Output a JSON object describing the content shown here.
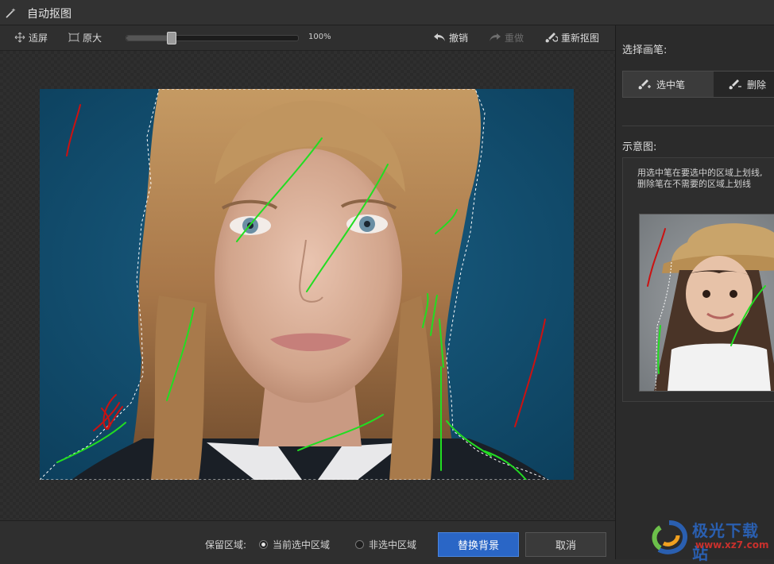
{
  "window": {
    "title": "自动抠图"
  },
  "toolbar": {
    "fit_label": "适屏",
    "actual_label": "原大",
    "zoom_value": "100%",
    "zoom_level": 0.26,
    "undo_label": "撤销",
    "redo_label": "重做",
    "redo_enabled": false,
    "remat_label": "重新抠图"
  },
  "right_panel": {
    "brush_heading": "选择画笔:",
    "brush_tabs": [
      {
        "label": "选中笔",
        "icon": "brush-add-icon",
        "active": true
      },
      {
        "label": "删除",
        "icon": "brush-remove-icon",
        "active": false
      }
    ],
    "hint_heading": "示意图:",
    "hint_lines": [
      "用选中笔在要选中的区域上划线,",
      "删除笔在不需要的区域上划线"
    ]
  },
  "bottom_bar": {
    "keep_label": "保留区域:",
    "options": [
      {
        "label": "当前选中区域",
        "selected": true
      },
      {
        "label": "非选中区域",
        "selected": false
      }
    ],
    "replace_bg_label": "替换背景",
    "cancel_label": "取消"
  },
  "watermark": {
    "brand": "极光下载站",
    "url": "www.xz7.com"
  },
  "colors": {
    "accent_button": "#2a66c6",
    "stroke_keep": "#22dd22",
    "stroke_remove": "#cc1111",
    "photo_background": "#0e4a6b"
  }
}
